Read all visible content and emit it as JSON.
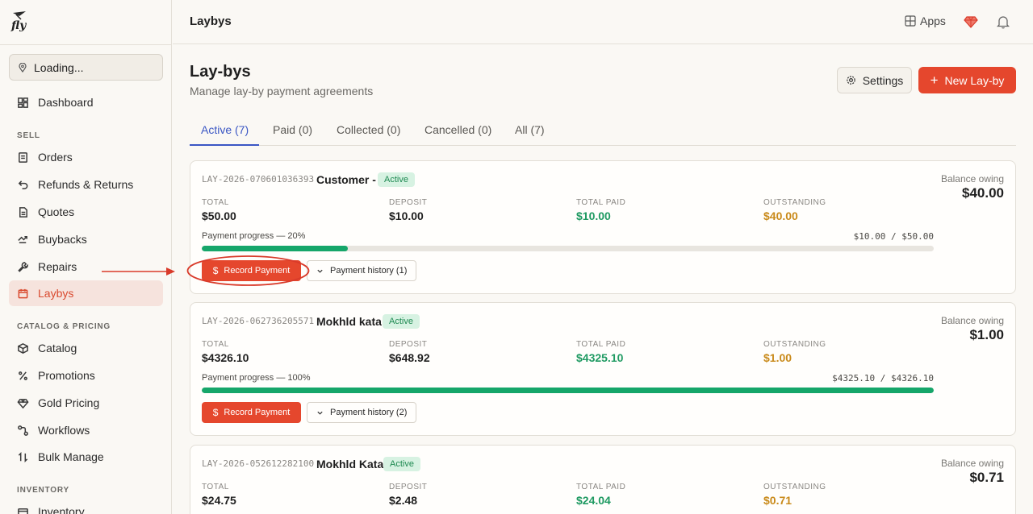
{
  "app": {
    "logo_text": "fly"
  },
  "sidebar": {
    "location": "Loading...",
    "dashboard": "Dashboard",
    "sections": {
      "sell": "SELL",
      "catalog": "CATALOG & PRICING",
      "inventory": "INVENTORY"
    },
    "items": [
      {
        "label": "Orders",
        "icon": "orders-icon"
      },
      {
        "label": "Refunds & Returns",
        "icon": "refund-icon"
      },
      {
        "label": "Quotes",
        "icon": "quotes-icon"
      },
      {
        "label": "Buybacks",
        "icon": "buybacks-icon"
      },
      {
        "label": "Repairs",
        "icon": "wrench-icon"
      },
      {
        "label": "Laybys",
        "icon": "calendar-icon",
        "active": true
      },
      {
        "label": "Catalog",
        "icon": "box-icon"
      },
      {
        "label": "Promotions",
        "icon": "percent-icon"
      },
      {
        "label": "Gold Pricing",
        "icon": "gem-icon"
      },
      {
        "label": "Workflows",
        "icon": "workflow-icon"
      },
      {
        "label": "Bulk Manage",
        "icon": "sort-icon"
      },
      {
        "label": "Inventory",
        "icon": "inventory-icon"
      }
    ]
  },
  "topbar": {
    "title": "Laybys",
    "apps": "Apps"
  },
  "header": {
    "title": "Lay-bys",
    "subtitle": "Manage lay-by payment agreements",
    "settings": "Settings",
    "new_button": "New Lay-by"
  },
  "tabs": [
    "Active (7)",
    "Paid (0)",
    "Collected (0)",
    "Cancelled (0)",
    "All (7)"
  ],
  "labels": {
    "balance_owing": "Balance owing",
    "total": "TOTAL",
    "deposit": "DEPOSIT",
    "total_paid": "TOTAL PAID",
    "outstanding": "OUTSTANDING",
    "record_payment": "Record Payment"
  },
  "colors": {
    "accent": "#e5472d",
    "green": "#1f9a62",
    "orange": "#c98a1a",
    "tab_active": "#3a56c4"
  },
  "laybys": [
    {
      "ref": "LAY-2026-070601036393",
      "customer": "Customer -",
      "status": "Active",
      "balance": "$40.00",
      "total": "$50.00",
      "deposit": "$10.00",
      "total_paid": "$10.00",
      "outstanding": "$40.00",
      "progress_label": "Payment progress — 20%",
      "progress_amount": "$10.00 / $50.00",
      "progress": 0.2,
      "history": "Payment history (1)"
    },
    {
      "ref": "LAY-2026-062736205571",
      "customer": "Mokhld kata",
      "status": "Active",
      "balance": "$1.00",
      "total": "$4326.10",
      "deposit": "$648.92",
      "total_paid": "$4325.10",
      "outstanding": "$1.00",
      "progress_label": "Payment progress — 100%",
      "progress_amount": "$4325.10 / $4326.10",
      "progress": 1.0,
      "history": "Payment history (2)"
    },
    {
      "ref": "LAY-2026-052612282100",
      "customer": "Mokhld Kata",
      "status": "Active",
      "balance": "$0.71",
      "total": "$24.75",
      "deposit": "$2.48",
      "total_paid": "$24.04",
      "outstanding": "$0.71"
    }
  ]
}
